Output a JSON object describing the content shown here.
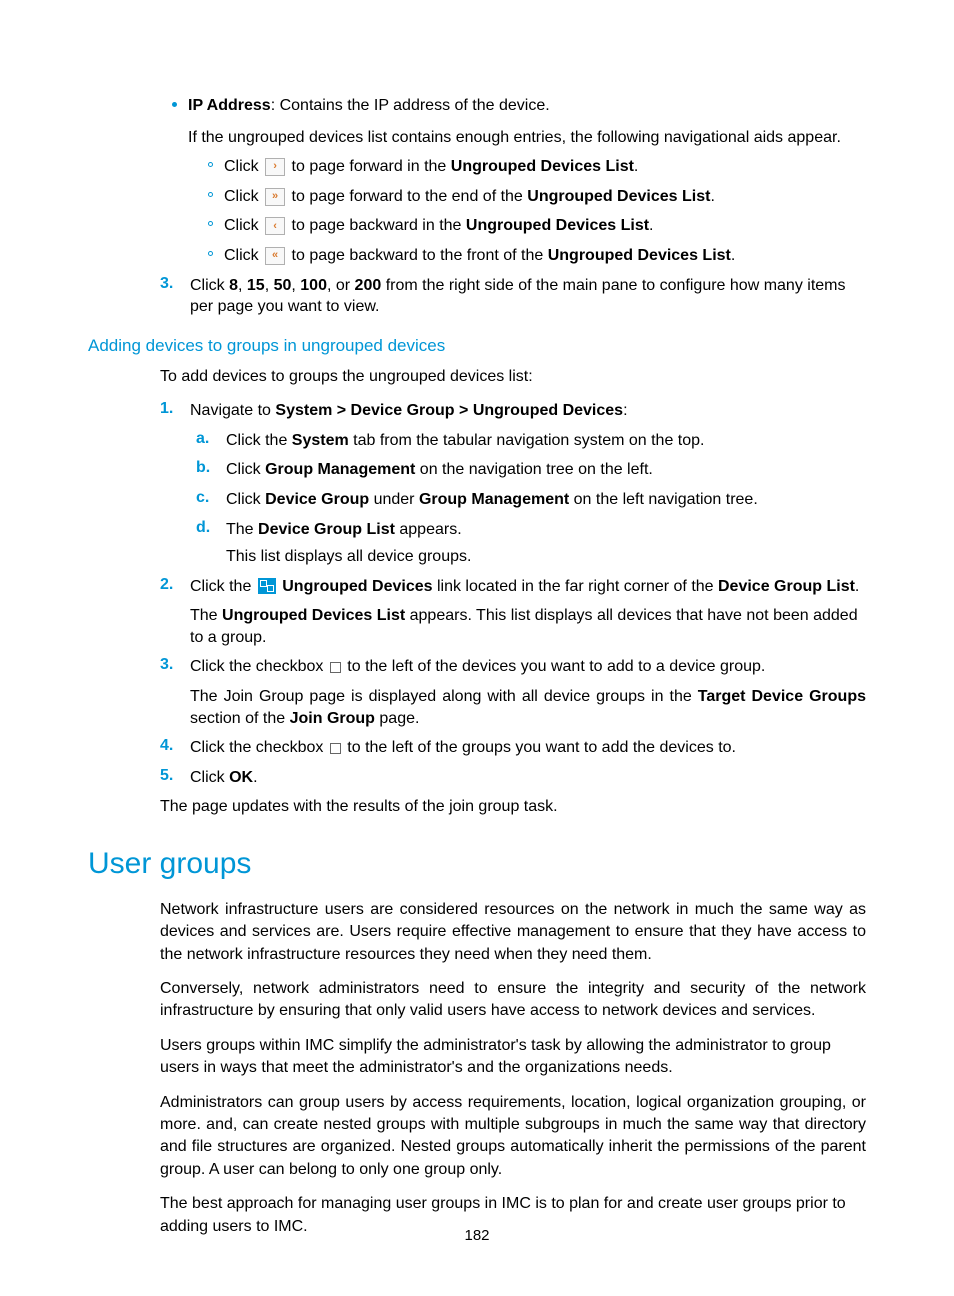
{
  "ip_address": {
    "label": "IP Address",
    "desc": ": Contains the IP address of the device.",
    "nav_intro": "If the ungrouped devices list contains enough entries, the following navigational aids appear."
  },
  "nav_items": [
    {
      "pre": "Click ",
      "icon": "›",
      "post": " to page forward in the ",
      "target": "Ungrouped Devices List",
      "end": "."
    },
    {
      "pre": "Click ",
      "icon": "»",
      "post": " to page forward to the end of the ",
      "target": "Ungrouped Devices List",
      "end": "."
    },
    {
      "pre": "Click ",
      "icon": "‹",
      "post": " to page backward in the ",
      "target": "Ungrouped Devices List",
      "end": "."
    },
    {
      "pre": "Click ",
      "icon": "«",
      "post": " to page backward to the front of the ",
      "target": "Ungrouped Devices List",
      "end": "."
    }
  ],
  "step3": {
    "num": "3.",
    "pre": "Click ",
    "n1": "8",
    "c1": ", ",
    "n2": "15",
    "c2": ", ",
    "n3": "50",
    "c3": ", ",
    "n4": "100",
    "c4": ", or ",
    "n5": "200",
    "post": " from the right side of the main pane to configure how many items per page you want to view."
  },
  "subsection_title": "Adding devices to groups in ungrouped devices",
  "sub_intro": "To add devices to groups the ungrouped devices list:",
  "sub_steps": {
    "s1": {
      "num": "1.",
      "pre": "Navigate to ",
      "path": "System > Device Group > Ungrouped Devices",
      "end": ":",
      "a": {
        "label": "a.",
        "pre": "Click the ",
        "b": "System",
        "post": " tab from the tabular navigation system on the top."
      },
      "b": {
        "label": "b.",
        "pre": "Click ",
        "b": "Group Management",
        "post": " on the navigation tree on the left."
      },
      "c": {
        "label": "c.",
        "pre": "Click ",
        "b1": "Device Group",
        "mid": " under ",
        "b2": "Group Management",
        "post": " on the left navigation tree."
      },
      "d": {
        "label": "d.",
        "pre": "The ",
        "b": "Device Group List",
        "post": " appears.",
        "cont": "This list displays all device groups."
      }
    },
    "s2": {
      "num": "2.",
      "pre": "Click the ",
      "b1": "Ungrouped Devices",
      "mid": " link located in the far right corner of the ",
      "b2": "Device Group List",
      "end": ".",
      "cont_pre": "The ",
      "cont_b": "Ungrouped Devices List",
      "cont_post": " appears. This list displays all devices that have not been added to a group."
    },
    "s3": {
      "num": "3.",
      "pre": "Click the checkbox ",
      "post": " to the left of the devices you want to add to a device group.",
      "cont_pre": "The Join Group page is displayed along with all device groups in the ",
      "cont_b": "Target Device Groups",
      "cont_mid": " section of the ",
      "cont_b2": "Join Group",
      "cont_end": " page."
    },
    "s4": {
      "num": "4.",
      "pre": "Click the checkbox ",
      "post": " to the left of the groups you want to add the devices to."
    },
    "s5": {
      "num": "5.",
      "pre": "Click ",
      "b": "OK",
      "end": "."
    }
  },
  "sub_outro": "The page updates with the results of the join group task.",
  "section_title": "User groups",
  "paras": [
    "Network infrastructure users are considered resources on the network in much the same way as devices and services are. Users require effective management to ensure that they have access to the network infrastructure resources they need when they need them.",
    "Conversely, network administrators need to ensure the integrity and security of the network infrastructure by ensuring that only valid users have access to network devices and services.",
    "Users groups within IMC simplify the administrator's task by allowing the administrator to group users in ways that meet the administrator's and the organizations needs.",
    "Administrators can group users by access requirements, location, logical organization grouping, or more. and, can create nested groups with multiple subgroups in much the same way that directory and file structures are organized. Nested groups automatically inherit the permissions of the parent group. A user can belong to only one group only.",
    "The best approach for managing user groups in IMC is to plan for and create user groups prior to adding users to IMC."
  ],
  "page_number": "182"
}
